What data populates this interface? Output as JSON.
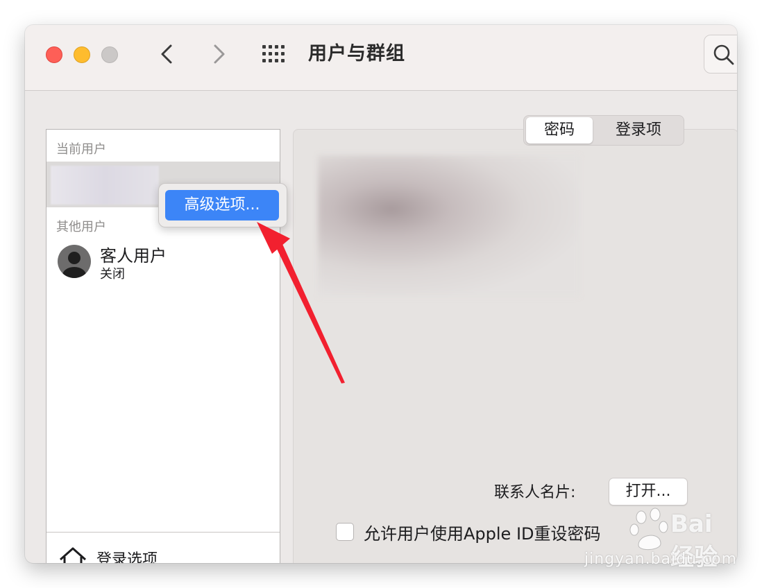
{
  "window": {
    "title": "用户与群组"
  },
  "sidebar": {
    "current_users_label": "当前用户",
    "other_users_label": "其他用户",
    "guest": {
      "name": "客人用户",
      "status": "关闭"
    },
    "login_options_label": "登录选项"
  },
  "context_menu": {
    "advanced_options": "高级选项..."
  },
  "tabs": [
    {
      "label": "密码",
      "selected": true
    },
    {
      "label": "登录项",
      "selected": false
    }
  ],
  "main": {
    "contact_card_label": "联系人名片:",
    "open_button": "打开...",
    "allow_reset_checkbox": {
      "label": "允许用户使用Apple ID重设密码",
      "checked": false
    }
  },
  "watermark": {
    "logo_text": "Bai 经验",
    "url": "jingyan.baidu.com"
  },
  "colors": {
    "highlight": "#3c85f7",
    "close": "#fe5f57",
    "minimize": "#febc2e",
    "annotation_arrow": "#f2202f"
  },
  "icons": [
    "back-chevron-icon",
    "forward-chevron-icon",
    "grid-icon",
    "search-icon",
    "avatar-icon",
    "house-icon"
  ]
}
